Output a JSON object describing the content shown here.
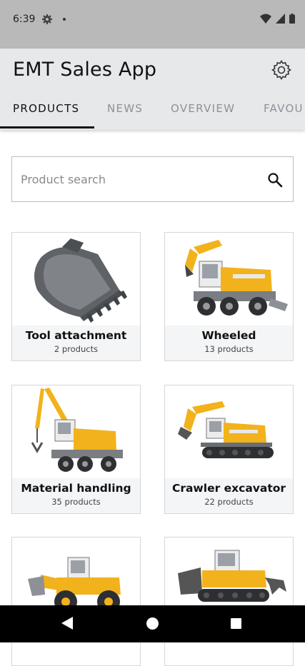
{
  "status_bar": {
    "time": "6:39"
  },
  "app": {
    "title": "EMT Sales App"
  },
  "tabs": [
    {
      "label": "PRODUCTS",
      "active": true
    },
    {
      "label": "NEWS",
      "active": false
    },
    {
      "label": "OVERVIEW",
      "active": false
    },
    {
      "label": "FAVOU",
      "active": false
    }
  ],
  "search": {
    "placeholder": "Product search",
    "value": ""
  },
  "categories": [
    {
      "name": "Tool attachment",
      "count": "2 products",
      "icon": "bucket-attachment-image"
    },
    {
      "name": "Wheeled",
      "count": "13 products",
      "icon": "wheeled-excavator-image"
    },
    {
      "name": "Material handling",
      "count": "35 products",
      "icon": "material-handler-image"
    },
    {
      "name": "Crawler excavator",
      "count": "22 products",
      "icon": "crawler-excavator-image"
    },
    {
      "name": "",
      "count": "",
      "icon": "wheel-loader-image"
    },
    {
      "name": "",
      "count": "",
      "icon": "crawler-dozer-image"
    }
  ],
  "colors": {
    "appbar": "#e6e8ea",
    "machine_yellow": "#f2b21b",
    "status_bar": "#b9b9b9"
  }
}
